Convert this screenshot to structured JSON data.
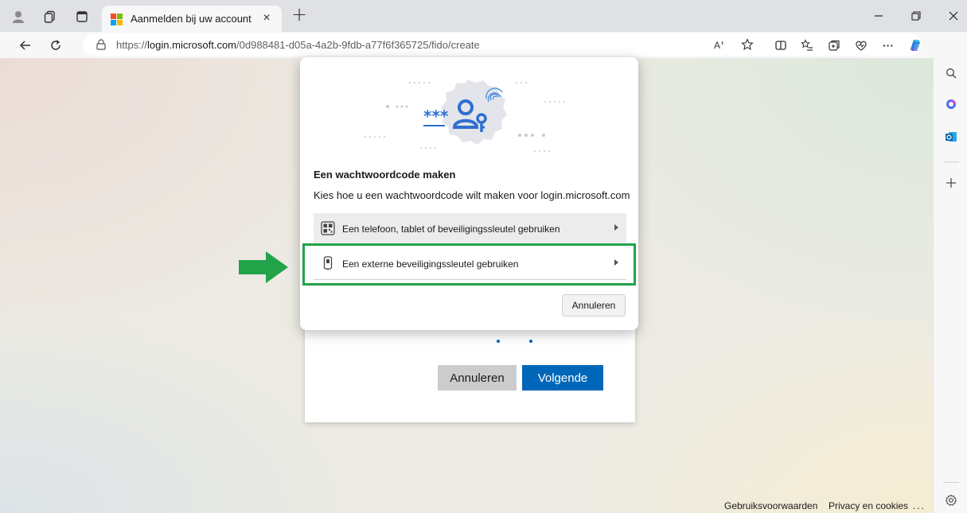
{
  "browser": {
    "tab": {
      "title": "Aanmelden bij uw account",
      "close": "×"
    },
    "new_tab": "+",
    "address_bar": {
      "scheme": "https://",
      "host": "login.microsoft.com",
      "path": "/0d988481-d05a-4a2b-9fdb-a77f6f365725/fido/create"
    },
    "toolbar_icons": [
      "read-aloud-icon",
      "favorite-star-icon",
      "split-screen-icon",
      "favorites-icon",
      "collections-icon",
      "browser-essentials-icon",
      "more-icon",
      "copilot-icon"
    ],
    "sidebar_icons": [
      "search-icon",
      "copilot-sidebar-icon",
      "outlook-icon",
      "add-icon",
      "settings-icon"
    ],
    "more_label": "···"
  },
  "dialog": {
    "title": "Een wachtwoordcode maken",
    "subtitle": "Kies hoe u een wachtwoordcode wilt maken voor login.microsoft.com",
    "options": [
      {
        "label": "Een telefoon, tablet of beveiligingssleutel gebruiken",
        "icon": "qr-code-icon"
      },
      {
        "label": "Een externe beveiligingssleutel gebruiken",
        "icon": "security-key-icon"
      }
    ],
    "cancel": "Annuleren",
    "illustration_text": "***"
  },
  "login_card": {
    "cancel": "Annuleren",
    "next": "Volgende"
  },
  "footer": {
    "terms": "Gebruiksvoorwaarden",
    "privacy": "Privacy en cookies",
    "more": "..."
  },
  "colors": {
    "accent_blue": "#0067b8",
    "highlight_green": "#22a34a",
    "ms_red": "#f25022",
    "ms_green": "#7fba00",
    "ms_blue": "#00a4ef",
    "ms_yellow": "#ffb900"
  }
}
